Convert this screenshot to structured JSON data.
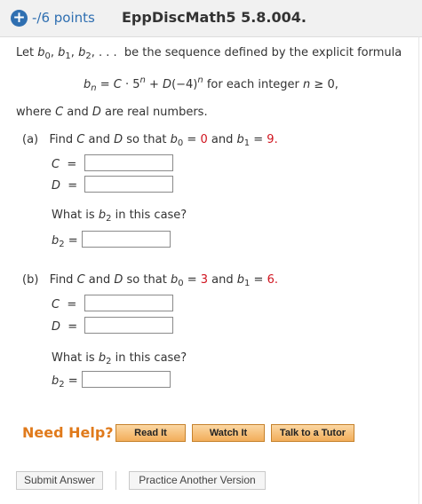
{
  "header": {
    "points": "-/6 points",
    "title": "EppDiscMath5 5.8.004."
  },
  "intro": {
    "pre": "Let b",
    "mid": "be the sequence defined by the explicit formula"
  },
  "formula": {
    "tail": "for each integer",
    "cond": "n ≥ 0,"
  },
  "where": "where C and D are real numbers.",
  "part_a": {
    "label": "(a)",
    "b0": "0",
    "b1": "9",
    "prompt": "What is b2 in this case?"
  },
  "part_b": {
    "label": "(b)",
    "b0": "3",
    "b1": "6",
    "prompt": "What is b2 in this case?"
  },
  "help": {
    "label": "Need Help?",
    "read": "Read It",
    "watch": "Watch It",
    "tutor": "Talk to a Tutor"
  },
  "footer": {
    "submit": "Submit Answer",
    "practice": "Practice Another Version"
  }
}
